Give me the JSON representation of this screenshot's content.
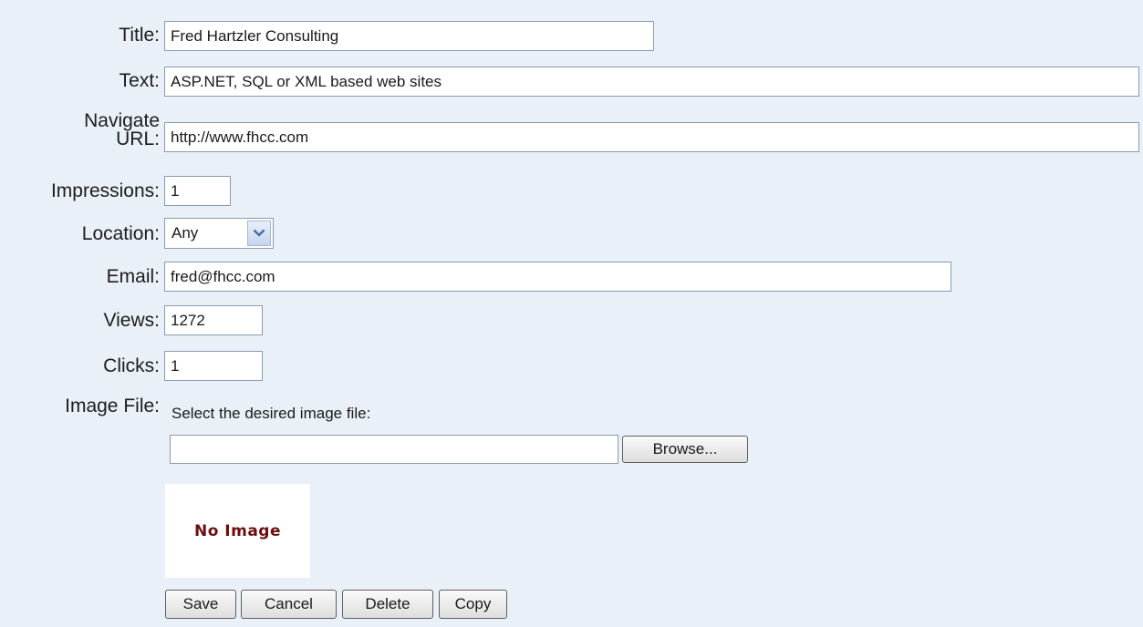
{
  "form": {
    "title": {
      "label": "Title:",
      "value": "Fred Hartzler Consulting"
    },
    "text": {
      "label": "Text:",
      "value": "ASP.NET, SQL or XML based web sites"
    },
    "navigate_url": {
      "label_line1": "Navigate",
      "label_line2": "URL:",
      "value": "http://www.fhcc.com"
    },
    "impressions": {
      "label": "Impressions:",
      "value": "1"
    },
    "location": {
      "label": "Location:",
      "value": "Any",
      "icon": "chevron-down-icon"
    },
    "email": {
      "label": "Email:",
      "value": "fred@fhcc.com"
    },
    "views": {
      "label": "Views:",
      "value": "1272"
    },
    "clicks": {
      "label": "Clicks:",
      "value": "1"
    },
    "image_file": {
      "label": "Image File:",
      "hint": "Select the desired image file:",
      "file_value": "",
      "browse_label": "Browse...",
      "placeholder_text": "No Image"
    }
  },
  "actions": {
    "save": "Save",
    "cancel": "Cancel",
    "delete": "Delete",
    "copy": "Copy"
  },
  "colors": {
    "background": "#e9f0f8",
    "no_image_text": "#6b0f0f"
  }
}
